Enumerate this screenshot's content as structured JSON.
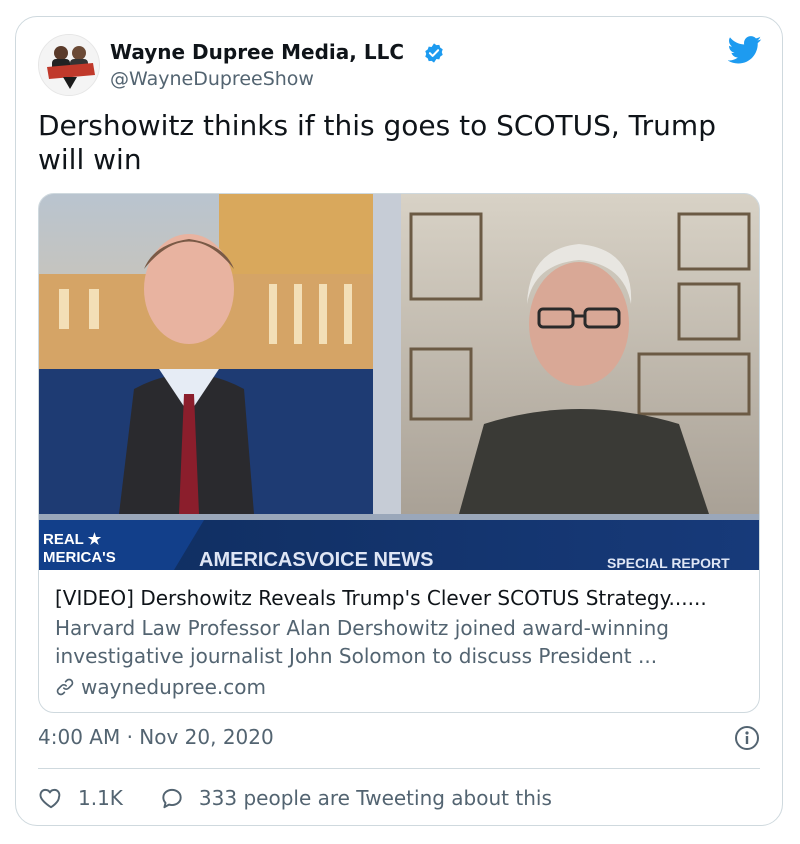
{
  "author": {
    "name": "Wayne Dupree Media, LLC",
    "handle": "@WayneDupreeShow",
    "avatar_text": "WAYNEDUPREE"
  },
  "tweet": {
    "text": "Dershowitz thinks if this goes to SCOTUS, Trump will win"
  },
  "link_card": {
    "media_banner_left": "REAL ★ AMERICA'S VOICE",
    "media_banner_center": "AMERICASVOICE NEWS",
    "media_banner_right": "SPECIAL REPORT",
    "title": "[VIDEO] Dershowitz Reveals Trump's Clever SCOTUS Strategy......",
    "description": "Harvard Law Professor Alan Dershowitz joined award-winning investigative journalist John Solomon to discuss President ...",
    "domain": "waynedupree.com"
  },
  "meta": {
    "timestamp": "4:00 AM · Nov 20, 2020"
  },
  "actions": {
    "likes": "1.1K",
    "conversation": "333 people are Tweeting about this"
  },
  "colors": {
    "twitter_blue": "#1d9bf0",
    "text_primary": "#0f1419",
    "text_secondary": "#536471",
    "border": "#cfd9de"
  },
  "icons": [
    "verified-icon",
    "twitter-icon",
    "link-icon",
    "info-icon",
    "heart-icon",
    "reply-icon"
  ]
}
